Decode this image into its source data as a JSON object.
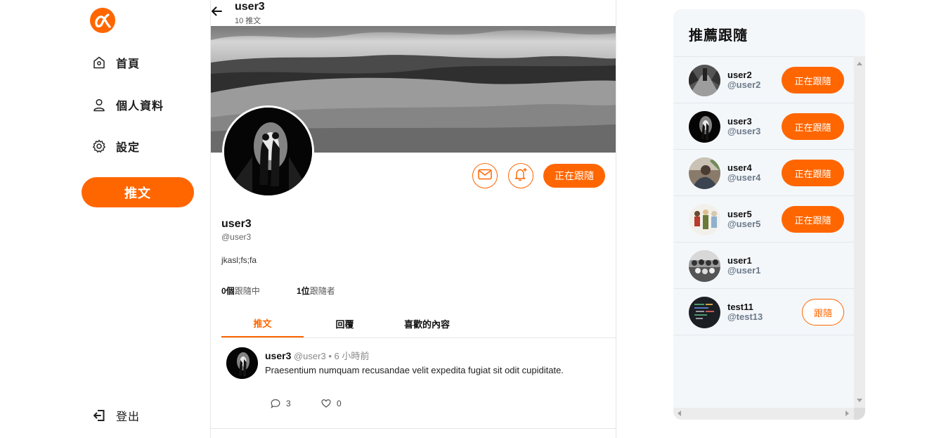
{
  "sidebar": {
    "logo": "alpha-logo-icon",
    "items": [
      {
        "label": "首頁",
        "icon": "home-icon"
      },
      {
        "label": "個人資料",
        "icon": "user-icon"
      },
      {
        "label": "設定",
        "icon": "gear-icon"
      }
    ],
    "tweet_button": "推文",
    "logout": {
      "label": "登出",
      "icon": "logout-icon"
    }
  },
  "header": {
    "name": "user3",
    "tweet_count": "10 推文"
  },
  "profile": {
    "name": "user3",
    "handle": "@user3",
    "bio": "jkasl;fs;fa",
    "following_count": "0個",
    "following_label": "跟隨中",
    "followers_count": "1位",
    "followers_label": "跟隨者",
    "follow_button": "正在跟隨",
    "accent": "#ff6600"
  },
  "tabs": [
    {
      "label": "推文",
      "active": true
    },
    {
      "label": "回覆",
      "active": false
    },
    {
      "label": "喜歡的內容",
      "active": false
    }
  ],
  "tweets": [
    {
      "name": "user3",
      "handle": "@user3",
      "time": "• 6 小時前",
      "text": "Praesentium numquam recusandae velit expedita fugiat sit odit cupiditate.",
      "replies": "3",
      "likes": "0"
    }
  ],
  "recommend": {
    "title": "推薦跟隨",
    "users": [
      {
        "name": "user2",
        "handle": "@user2",
        "button": "正在跟隨",
        "following": true
      },
      {
        "name": "user3",
        "handle": "@user3",
        "button": "正在跟隨",
        "following": true
      },
      {
        "name": "user4",
        "handle": "@user4",
        "button": "正在跟隨",
        "following": true
      },
      {
        "name": "user5",
        "handle": "@user5",
        "button": "正在跟隨",
        "following": true
      },
      {
        "name": "user1",
        "handle": "@user1",
        "button": "",
        "following": false
      },
      {
        "name": "test11",
        "handle": "@test13",
        "button": "跟隨",
        "following": false
      }
    ]
  }
}
